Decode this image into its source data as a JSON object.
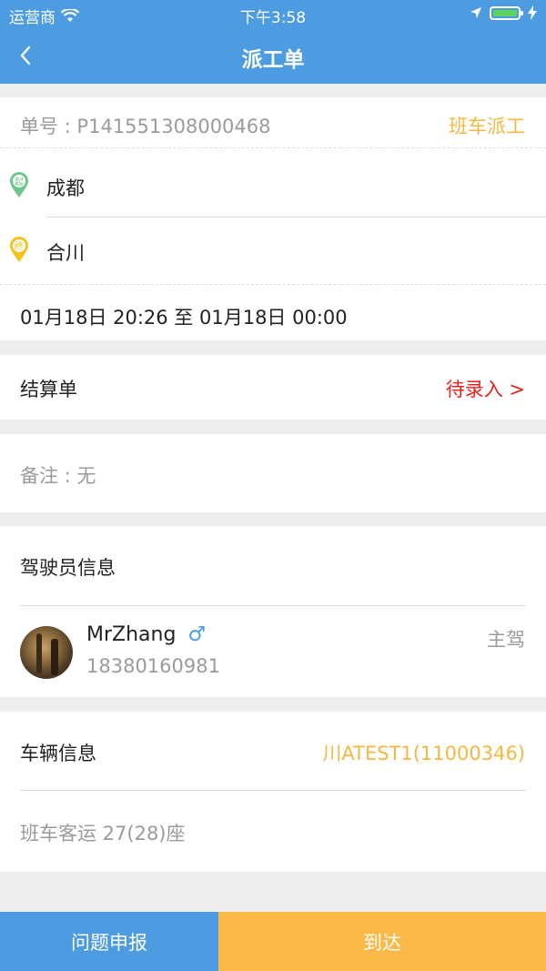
{
  "status_bar": {
    "carrier": "运营商",
    "time": "下午3:58"
  },
  "nav": {
    "title": "派工单"
  },
  "order": {
    "number": "单号 : P141551308000468",
    "type": "班车派工",
    "start_pin": "起",
    "start": "成都",
    "end_pin": "终",
    "end": "合川",
    "time_range": "01月18日 20:26 至 01月18日 00:00"
  },
  "settlement": {
    "label": "结算单",
    "status": "待录入 >"
  },
  "remark": {
    "text": "备注 : 无"
  },
  "driver": {
    "section_title": "驾驶员信息",
    "name": "MrZhang",
    "gender_icon": "♂",
    "role": "主驾",
    "phone": "18380160981"
  },
  "vehicle": {
    "section_title": "车辆信息",
    "plate": "川ATEST1(11000346)",
    "description": "班车客运  27(28)座"
  },
  "footer": {
    "report_label": "问题申报",
    "arrive_label": "到达"
  },
  "colors": {
    "header_bg": "#4d9be0",
    "orange": "#f6b840",
    "red": "#e8231d",
    "green_pin": "#6bc78a",
    "yellow_pin": "#f5c21b",
    "arrive_bg": "#fbb94a"
  }
}
